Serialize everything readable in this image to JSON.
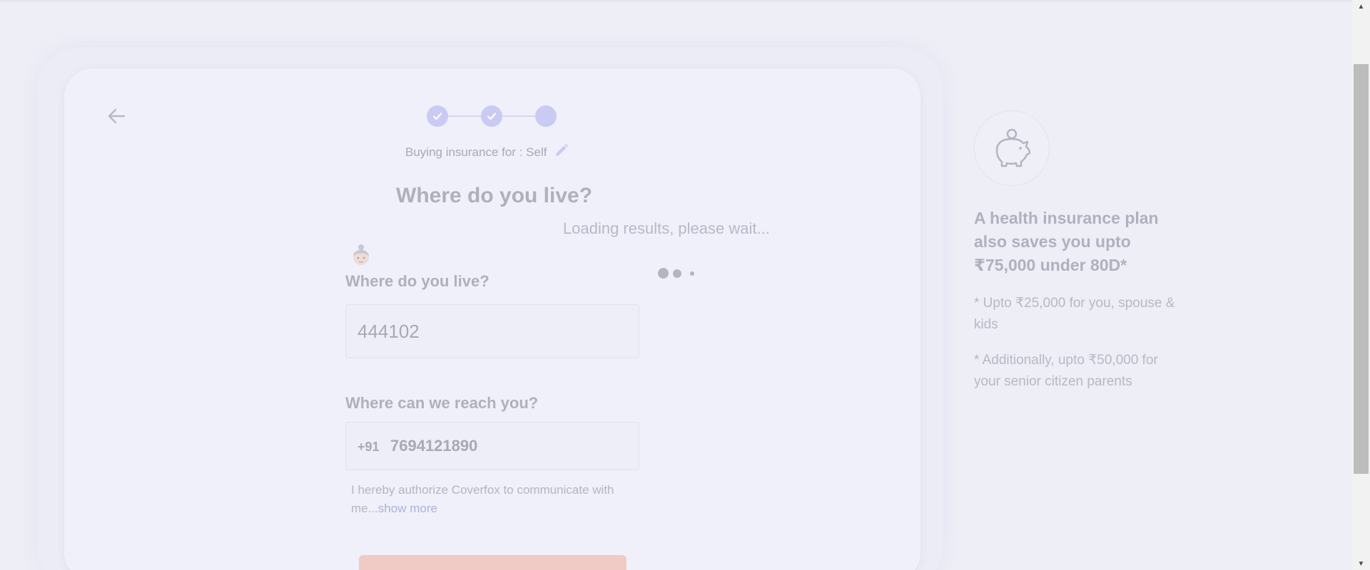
{
  "header": {
    "buying_for_label": "Buying insurance for : Self",
    "title": "Where do you live?"
  },
  "stepper": {
    "steps": [
      "completed",
      "completed",
      "current"
    ]
  },
  "loading": {
    "message": "Loading results, please wait..."
  },
  "form": {
    "pincode_label": "Where do you live?",
    "pincode_value": "444102",
    "phone_label": "Where can we reach you?",
    "phone_prefix": "+91",
    "phone_value": "7694121890",
    "consent_text": "I hereby authorize Coverfox to communicate with me...",
    "consent_more": "show more"
  },
  "promo": {
    "title": "A health insurance plan also saves you upto ₹75,000 under 80D*",
    "note_1": "* Upto ₹25,000 for you, spouse & kids",
    "note_2": "* Additionally, upto ₹50,000 for your senior citizen parents"
  },
  "icons": {
    "back": "arrow-left-icon",
    "edit": "pencil-icon",
    "check": "checkmark-icon",
    "savings": "piggy-bank-icon",
    "avatar": "user-avatar-icon"
  },
  "colors": {
    "accent": "#c9cbf3",
    "cta": "#f0cbc5",
    "background": "#eeeef7"
  }
}
